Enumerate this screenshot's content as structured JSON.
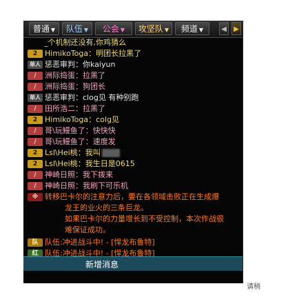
{
  "tabs": [
    {
      "label": "普通",
      "arrow": "▼",
      "color": "#f0f0f0"
    },
    {
      "label": "队伍",
      "arrow": "▼",
      "color": "#9ec8ff"
    },
    {
      "label": "公会",
      "arrow": "▼",
      "color": "#ff74c8"
    },
    {
      "label": "攻坚队",
      "arrow": "▼",
      "color": "#ffd27a"
    },
    {
      "label": "频道",
      "arrow": "▼",
      "color": "#f0f0f0"
    }
  ],
  "scroll_left_icon": "◀",
  "scroll_right_icon": "▶",
  "chat_lines": [
    {
      "badge": "",
      "name": "",
      "sep": "",
      "text": "_个机制还没有,你鸡猜么",
      "name_color": "y"
    },
    {
      "badge": "2",
      "name": "HimikoToga",
      "sep": "：",
      "text": "明团长拉黑了",
      "name_color": "y"
    },
    {
      "badge": "单人",
      "name": "惩恶审判",
      "sep": "：",
      "text": "你kaiyun",
      "name_color": "w"
    },
    {
      "badge": "/",
      "name": "洲际捣蛋",
      "sep": "：",
      "text": "拉黑了",
      "name_color": "p"
    },
    {
      "badge": "/",
      "name": "洲际捣蛋",
      "sep": "：",
      "text": "狗团长",
      "name_color": "p"
    },
    {
      "badge": "单人",
      "name": "惩恶审判",
      "sep": "：",
      "text": "clog见  有种别跑",
      "name_color": "w"
    },
    {
      "badge": "/",
      "name": "田所浩二",
      "sep": "：",
      "text": "拉黑了",
      "name_color": "p"
    },
    {
      "badge": "2",
      "name": "HimikoToga",
      "sep": "：",
      "text": "colg见",
      "name_color": "y"
    },
    {
      "badge": "/",
      "name": "哥\\玩鳗鱼了",
      "sep": "：",
      "text": "快快快",
      "name_color": "p"
    },
    {
      "badge": "/",
      "name": "哥\\玩鳗鱼了",
      "sep": "：",
      "text": "速度发",
      "name_color": "p"
    },
    {
      "badge": "2",
      "name": "Lsl\\Hei桃",
      "sep": "：",
      "text": "我叫",
      "name_color": "y",
      "blur": true
    },
    {
      "badge": "2",
      "name": "Lsl\\Hei桃",
      "sep": "：",
      "text": "我生日是0615",
      "name_color": "y"
    },
    {
      "badge": "/",
      "name": "神崎日照",
      "sep": "：",
      "text": "我下拨来",
      "name_color": "p"
    },
    {
      "badge": "/",
      "name": "神崎日照",
      "sep": "：",
      "text": "我刷下可乐机",
      "name_color": "p"
    }
  ],
  "system_message": {
    "badge": "※",
    "line1": "转移巴卡尔的注意力后，要在各领域击败正在生成爆",
    "line2": "龙王的业火的三条巨龙。",
    "line3": "如果巴卡尔的力量增长到不受控制，本次作战很",
    "line4": "难保证成功。"
  },
  "team_lines": [
    {
      "badge": "队",
      "text": "队伍:冲进战斗中! - [悍龙布鲁特]"
    },
    {
      "badge": "红",
      "text": "队伍:冲进战斗中! - [悍龙布鲁特]"
    }
  ],
  "new_message_label": "新增消息",
  "below_text": "请稍"
}
